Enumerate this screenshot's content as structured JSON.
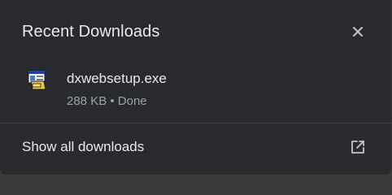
{
  "panel": {
    "title": "Recent Downloads",
    "close_icon": "close-icon"
  },
  "downloads": [
    {
      "file_name": "dxwebsetup.exe",
      "size": "288 KB",
      "separator": "•",
      "status": "Done",
      "meta_text": "288 KB • Done",
      "icon": "installer-file-icon"
    }
  ],
  "footer": {
    "label": "Show all downloads",
    "icon": "open-in-new-icon"
  },
  "colors": {
    "background": "#292a2d",
    "text_primary": "#e8eaed",
    "text_secondary": "#9aa0a6"
  }
}
